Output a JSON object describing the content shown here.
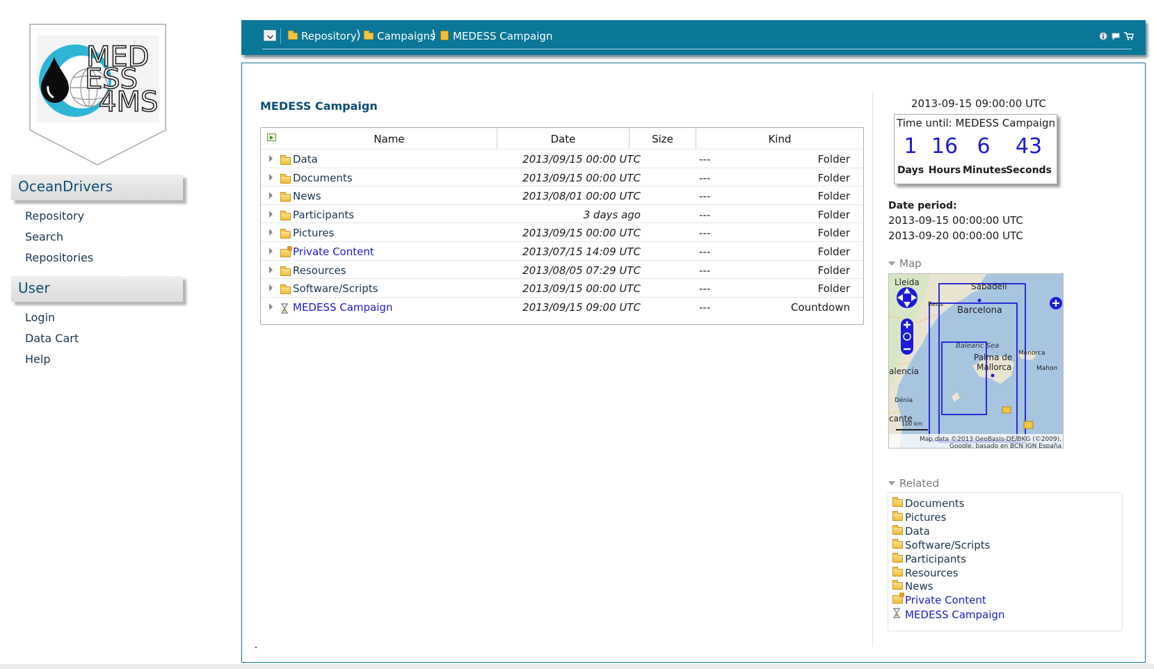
{
  "logo": {
    "text_lines": [
      "MED",
      "ESS",
      "4MS"
    ]
  },
  "sidebar": {
    "sections": [
      {
        "title": "OceanDrivers",
        "links": [
          "Repository",
          "Search",
          "Repositories"
        ]
      },
      {
        "title": "User",
        "links": [
          "Login",
          "Data Cart",
          "Help"
        ]
      }
    ]
  },
  "breadcrumb": {
    "items": [
      {
        "label": "Repository",
        "icon": "folder-icon"
      },
      {
        "label": "Campaigns",
        "icon": "folder-icon"
      },
      {
        "label": "MEDESS Campaign",
        "icon": "campaign-icon"
      }
    ],
    "separator": "⟩",
    "right_icons": [
      "info-icon",
      "comment-icon",
      "cart-icon"
    ]
  },
  "page": {
    "title": "MEDESS Campaign"
  },
  "table": {
    "columns": [
      "Name",
      "Date",
      "Size",
      "Kind"
    ],
    "rows": [
      {
        "name": "Data",
        "date": "2013/09/15 00:00 UTC",
        "size": "---",
        "kind": "Folder",
        "icon": "folder-icon",
        "style": "dark"
      },
      {
        "name": "Documents",
        "date": "2013/09/15 00:00 UTC",
        "size": "---",
        "kind": "Folder",
        "icon": "folder-icon",
        "style": "dark"
      },
      {
        "name": "News",
        "date": "2013/08/01 00:00 UTC",
        "size": "---",
        "kind": "Folder",
        "icon": "folder-icon",
        "style": "dark"
      },
      {
        "name": "Participants",
        "date": "3 days ago",
        "size": "---",
        "kind": "Folder",
        "icon": "folder-icon",
        "style": "dark"
      },
      {
        "name": "Pictures",
        "date": "2013/09/15 00:00 UTC",
        "size": "---",
        "kind": "Folder",
        "icon": "folder-icon",
        "style": "dark"
      },
      {
        "name": "Private Content",
        "date": "2013/07/15 14:09 UTC",
        "size": "---",
        "kind": "Folder",
        "icon": "private-folder-icon",
        "style": "blue"
      },
      {
        "name": "Resources",
        "date": "2013/08/05 07:29 UTC",
        "size": "---",
        "kind": "Folder",
        "icon": "folder-icon",
        "style": "dark"
      },
      {
        "name": "Software/Scripts",
        "date": "2013/09/15 00:00 UTC",
        "size": "---",
        "kind": "Folder",
        "icon": "folder-icon",
        "style": "dark"
      },
      {
        "name": "MEDESS Campaign",
        "date": "2013/09/15 09:00 UTC",
        "size": "---",
        "kind": "Countdown",
        "icon": "hourglass-icon",
        "style": "blue"
      }
    ]
  },
  "countdown": {
    "target_date": "2013-09-15 09:00:00 UTC",
    "label": "Time until: MEDESS Campaign",
    "values": [
      {
        "num": "1",
        "unit": "Days"
      },
      {
        "num": "16",
        "unit": "Hours"
      },
      {
        "num": "6",
        "unit": "Minutes"
      },
      {
        "num": "43",
        "unit": "Seconds"
      }
    ]
  },
  "period": {
    "title": "Date period:",
    "start": "2013-09-15 00:00:00 UTC",
    "end": "2013-09-20 00:00:00 UTC"
  },
  "map": {
    "title": "Map",
    "labels": {
      "lleida": "Lleida",
      "sabadell": "Sabadell",
      "barcelona": "Barcelona",
      "reus": "Reus",
      "balearic_sea": "Balearic Sea",
      "palma": "Palma de",
      "mallorca": "Mallorca",
      "menorca": "Menorca",
      "mahon": "Mahon",
      "valencia": "alencia",
      "denia": "Dénia",
      "alicante": "cante",
      "scale": "100 km"
    },
    "attribution_1": "Map data ©2013 GeoBasis-DE/BKG (©2009),",
    "attribution_2": "Google, basado en BCN IGN España"
  },
  "related": {
    "title": "Related",
    "items": [
      {
        "label": "Documents",
        "icon": "folder-icon",
        "style": "dark"
      },
      {
        "label": "Pictures",
        "icon": "folder-icon",
        "style": "dark"
      },
      {
        "label": "Data",
        "icon": "folder-icon",
        "style": "dark"
      },
      {
        "label": "Software/Scripts",
        "icon": "folder-icon",
        "style": "dark"
      },
      {
        "label": "Participants",
        "icon": "folder-icon",
        "style": "dark"
      },
      {
        "label": "Resources",
        "icon": "folder-icon",
        "style": "dark"
      },
      {
        "label": "News",
        "icon": "folder-icon",
        "style": "dark"
      },
      {
        "label": "Private Content",
        "icon": "private-folder-icon",
        "style": "blue"
      },
      {
        "label": "MEDESS Campaign",
        "icon": "hourglass-icon",
        "style": "blue"
      }
    ]
  },
  "colors": {
    "topbar": "#0a7798",
    "title": "#0d4d75",
    "link_blue": "#1a1ad6",
    "link_dark": "#18344e"
  }
}
